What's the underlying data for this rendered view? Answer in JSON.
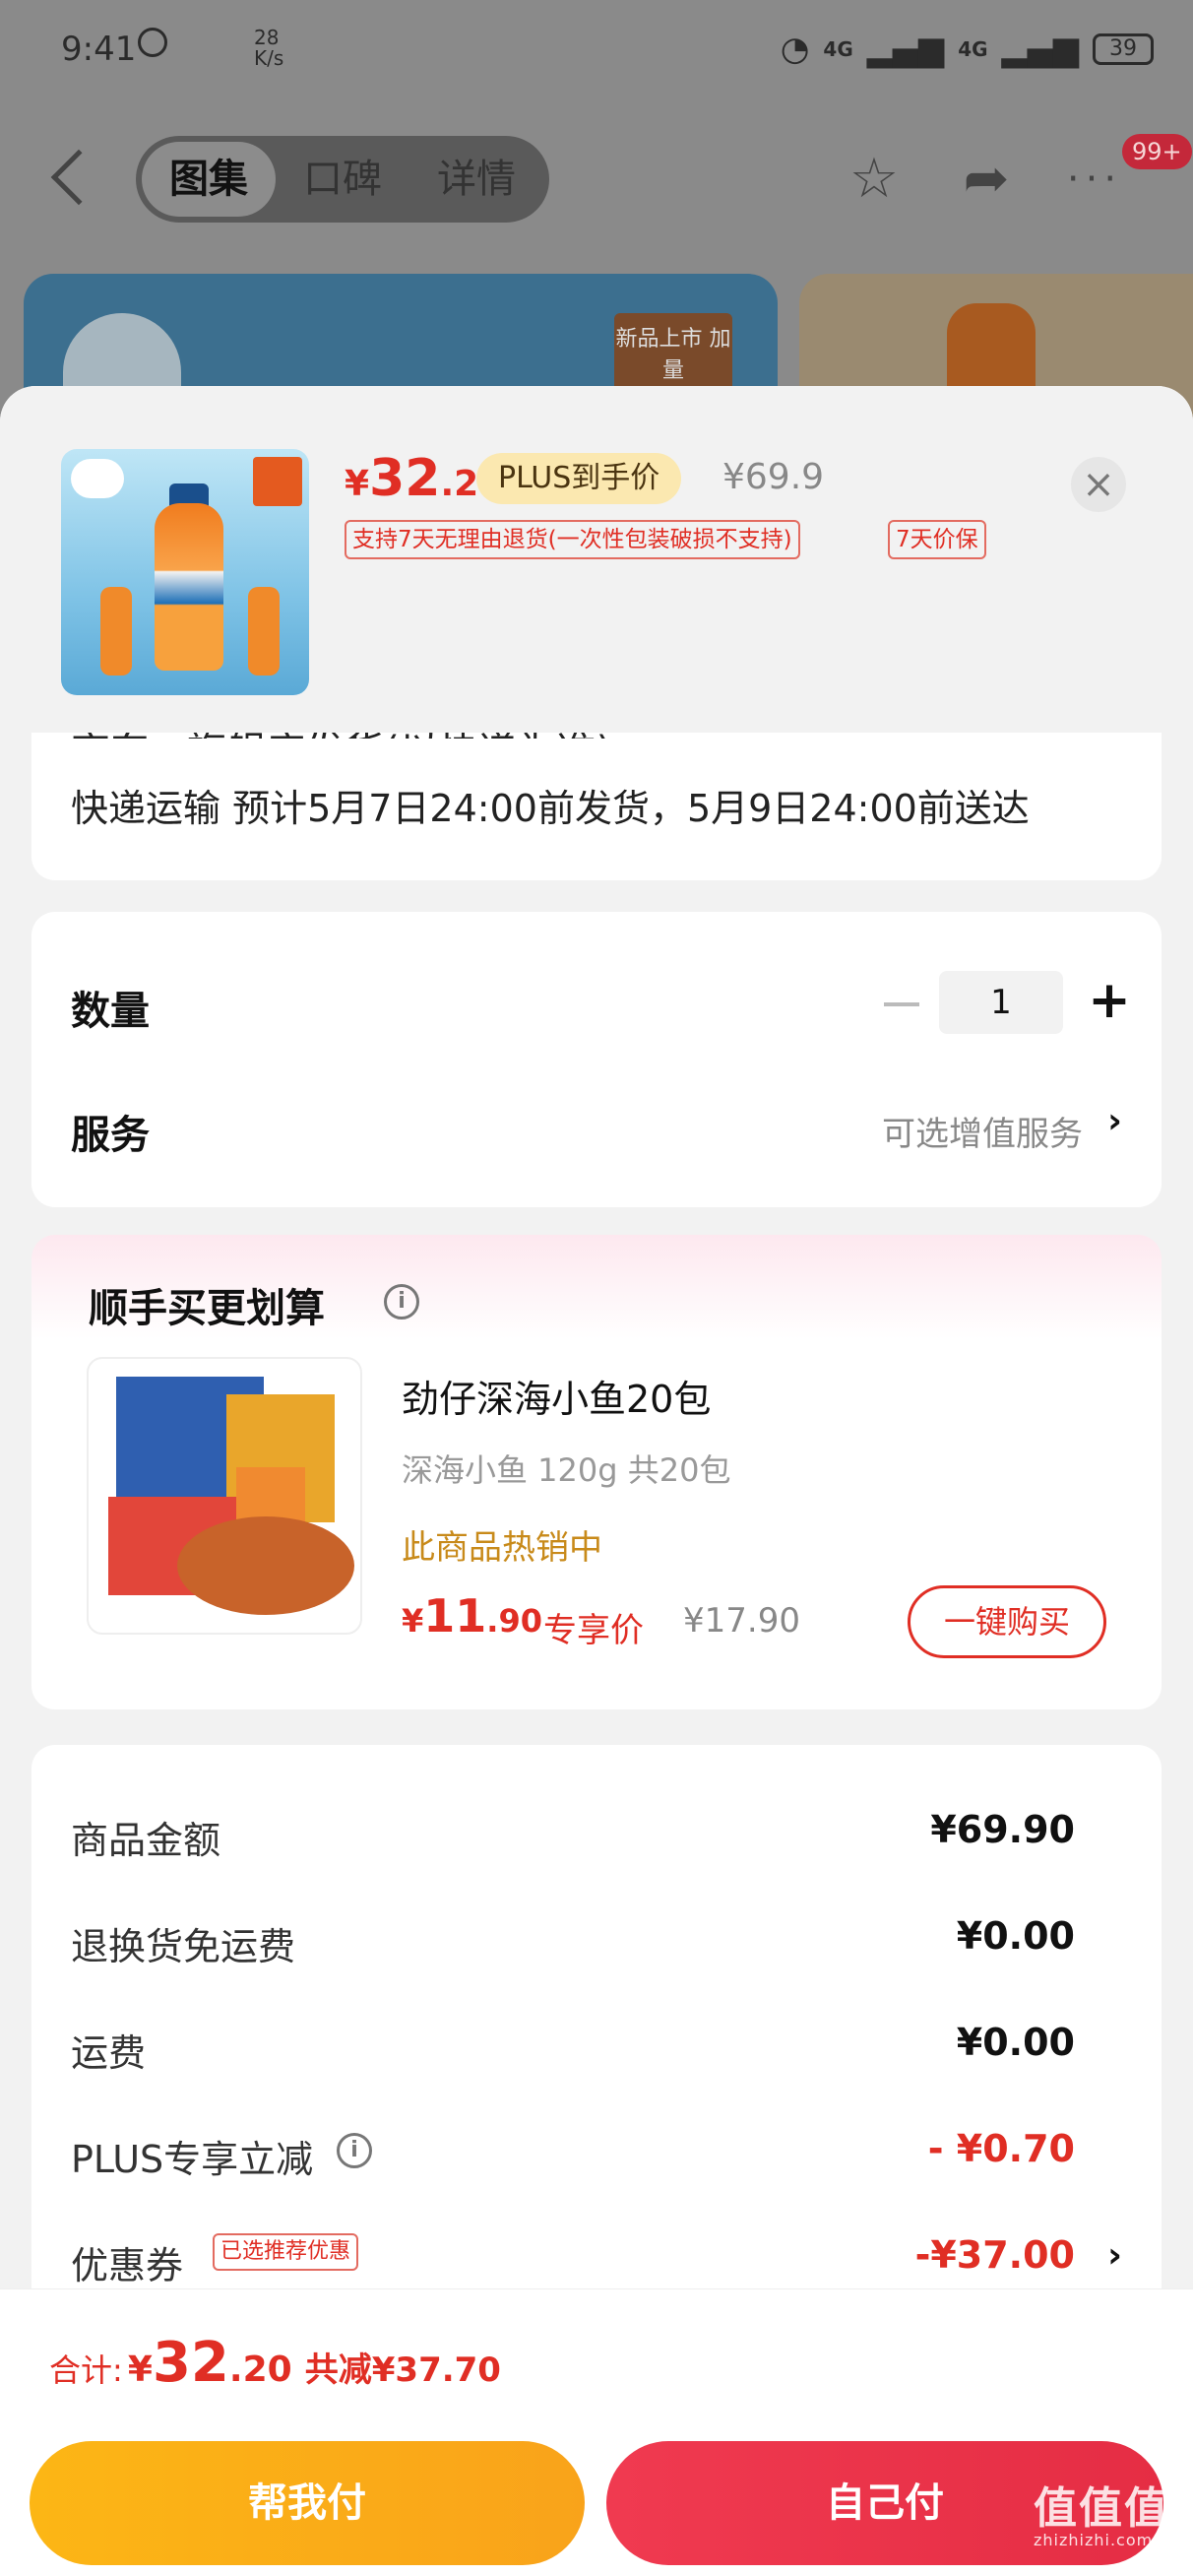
{
  "status_bar": {
    "time": "9:41",
    "speed_num": "28",
    "speed_unit": "K/s",
    "net1": "4G",
    "net2": "4G",
    "battery": "39"
  },
  "nav": {
    "tabs": [
      "图集",
      "口碑",
      "详情"
    ],
    "badge": "99+"
  },
  "bg_card": {
    "new_tag": "新品上市\n加量"
  },
  "sheet": {
    "price_symbol": "¥",
    "price_int": "32",
    "price_dec": ".2",
    "plus_tag": "PLUS到手价",
    "original_price": "¥69.9",
    "return_tag": "支持7天无理由退货(一次性包装破损不支持)",
    "price_protect_tag": "7天价保",
    "close": "×"
  },
  "shipping": {
    "store_line": "京东 · 旗舰店发货(以快递为准)",
    "delivery_text": "快递运输 预计5月7日24:00前发货，5月9日24:00前送达"
  },
  "quantity": {
    "label": "数量",
    "value": "1",
    "minus": "−",
    "plus": "+"
  },
  "service": {
    "label": "服务",
    "value": "可选增值服务",
    "chevron": "›"
  },
  "upsell": {
    "title": "顺手买更划算",
    "info": "i",
    "product_name": "劲仔深海小鱼20包",
    "spec": "深海小鱼 120g 共20包",
    "hot": "此商品热销中",
    "price_symbol": "¥",
    "price_int": "11",
    "price_dec": ".90",
    "exclusive": "专享价",
    "original_price": "¥17.90",
    "buy_button": "一键购买"
  },
  "summary": {
    "rows": [
      {
        "label": "商品金额",
        "value": "¥69.90"
      },
      {
        "label": "退换货免运费",
        "value": "¥0.00"
      },
      {
        "label": "运费",
        "value": "¥0.00"
      },
      {
        "label": "PLUS专享立减",
        "value": "- ¥0.70"
      },
      {
        "label": "优惠券",
        "value": "-¥37.00"
      }
    ],
    "coupon_tag": "已选推荐优惠",
    "coupon_chevron": "›"
  },
  "footer": {
    "total_label": "合计:",
    "total_symbol": "¥",
    "total_int": "32",
    "total_dec": ".20",
    "total_cut": "共减¥37.70",
    "help_pay": "帮我付",
    "self_pay": "自己付"
  },
  "watermark": {
    "main": "值值值",
    "sub": "zhizhizhi.com"
  },
  "colors": {
    "accent_red": "#e02e24",
    "gold": "#fcb615",
    "pay_red": "#e52d44"
  }
}
